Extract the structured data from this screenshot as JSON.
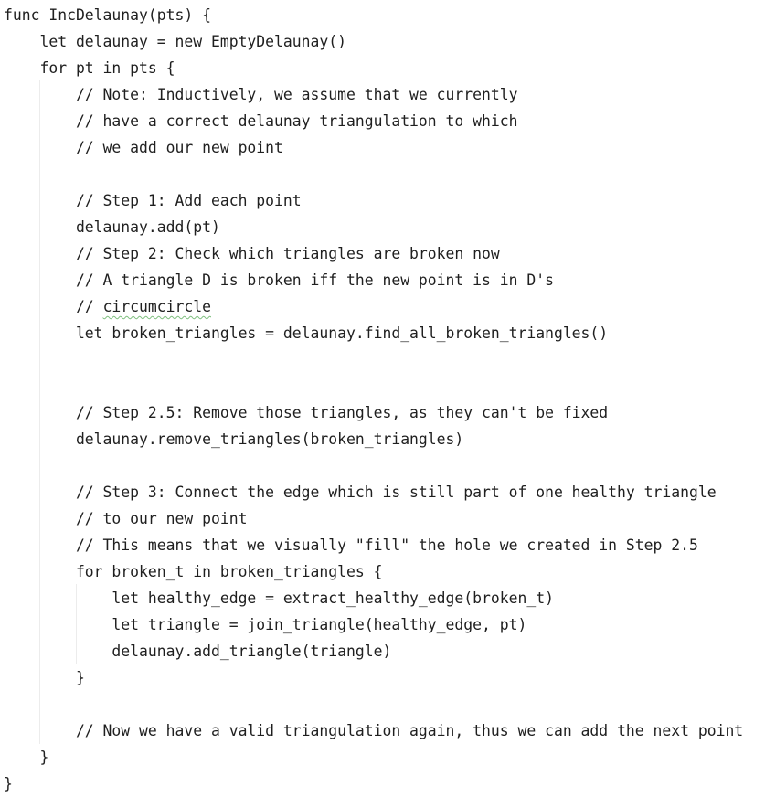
{
  "editor": {
    "lines": [
      "func IncDelaunay(pts) {",
      "    let delaunay = new EmptyDelaunay()",
      "    for pt in pts {",
      "        // Note: Inductively, we assume that we currently",
      "        // have a correct delaunay triangulation to which",
      "        // we add our new point",
      "",
      "        // Step 1: Add each point",
      "        delaunay.add(pt)",
      "        // Step 2: Check which triangles are broken now",
      "        // A triangle D is broken iff the new point is in D's",
      "",
      "        let broken_triangles = delaunay.find_all_broken_triangles()",
      "",
      "",
      "        // Step 2.5: Remove those triangles, as they can't be fixed",
      "        delaunay.remove_triangles(broken_triangles)",
      "",
      "        // Step 3: Connect the edge which is still part of one healthy triangle",
      "        // to our new point",
      "        // This means that we visually \"fill\" the hole we created in Step 2.5",
      "        for broken_t in broken_triangles {",
      "            let healthy_edge = extract_healthy_edge(broken_t)",
      "            let triangle = join_triangle(healthy_edge, pt)",
      "            delaunay.add_triangle(triangle)",
      "        }",
      "",
      "        // Now we have a valid triangulation again, thus we can add the next point",
      "    }",
      "}"
    ],
    "circumcircle_prefix": "        // ",
    "circumcircle_word": "circumcircle"
  }
}
